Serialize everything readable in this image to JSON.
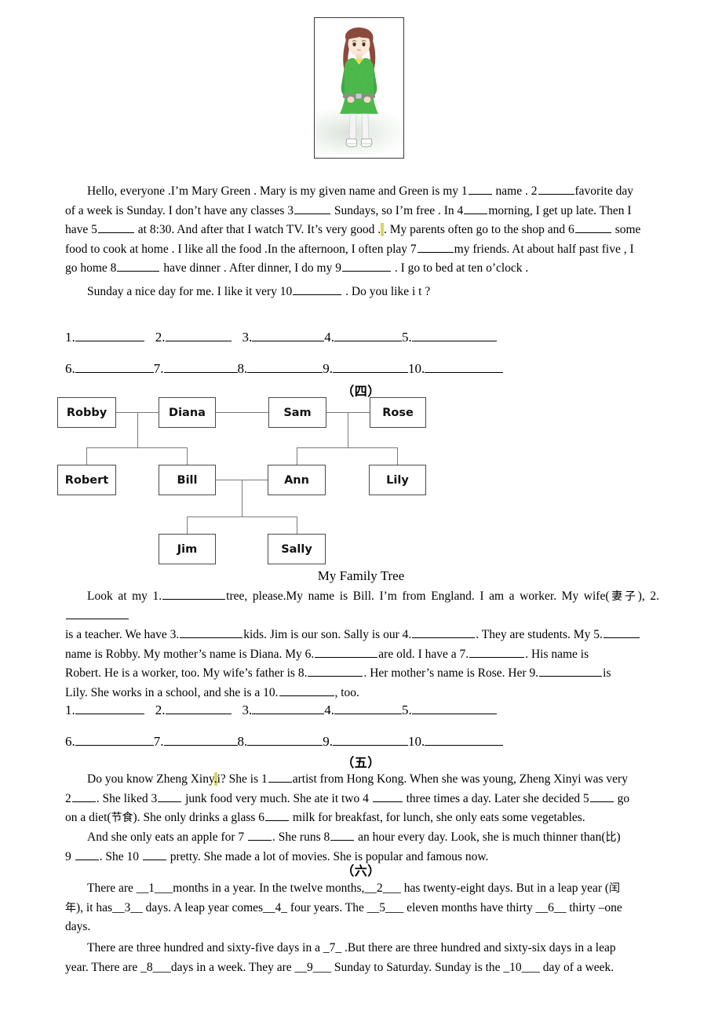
{
  "document": {
    "illustration": {
      "alt_name": "cartoon-girl-green-dress",
      "dress_color": "#4cb84c",
      "hair_color": "#8b4a3a",
      "skin_color": "#f7e0cf"
    }
  },
  "passage3": {
    "lines": [
      "Hello, everyone .I’m Mary Green . Mary is my given name and Green is my 1____ name . 2______favorite day",
      "of a week is Sunday. I don’t have any classes 3______ Sundays, so I’m free . In 4____morning, I get up late. Then I",
      "have 5______ at 8:30. And after that I watch TV. It’s very good .. My parents often go to the shop and 6______ some",
      "food to cook at home . I like all the food .In the afternoon, I often play 7______my friends. At about half past five , I",
      "go home 8_______ have dinner . After dinner, I do my 9________ . I go to bed at ten o’clock .",
      "Sunday a nice day for me. I like it very 10________ . Do you like i t ?"
    ],
    "segments_line1": [
      "Hello, everyone .I’m Mary Green . Mary is my given name and Green is my 1",
      " name . 2",
      "favorite day"
    ],
    "segments_line2": [
      "of a week is Sunday. I don’t have any classes 3",
      " Sundays, so I’m free . In 4",
      "morning, I get up late. Then I"
    ],
    "segments_line3": [
      "have 5",
      " at 8:30. And after that I watch TV. It’s very good .",
      ". My parents often go to the shop and 6",
      " some"
    ],
    "segments_line4": [
      "food to cook at home . I like all the food .In the afternoon, I often play 7",
      "my friends. At about half past five , I"
    ],
    "segments_line5": [
      "go home 8",
      " have dinner . After dinner, I do my 9",
      " . I go to bed at ten o’clock ."
    ],
    "segments_line6": [
      "Sunday a nice day for me. I like it very 10",
      " . Do you like i t ?"
    ]
  },
  "answers_block_1": {
    "row1": [
      "1.",
      "2.",
      "3.",
      "4.",
      "5."
    ],
    "row2": [
      "6.",
      "7.",
      "8.",
      "9.",
      "10."
    ]
  },
  "section_four": {
    "caption": "（四）",
    "tree_title": "My Family Tree",
    "nodes": [
      {
        "id": "robby",
        "label": "Robby"
      },
      {
        "id": "diana",
        "label": "Diana"
      },
      {
        "id": "sam",
        "label": "Sam"
      },
      {
        "id": "rose",
        "label": "Rose"
      },
      {
        "id": "robert",
        "label": "Robert"
      },
      {
        "id": "bill",
        "label": "Bill"
      },
      {
        "id": "ann",
        "label": "Ann"
      },
      {
        "id": "lily",
        "label": "Lily"
      },
      {
        "id": "jim",
        "label": "Jim"
      },
      {
        "id": "sally",
        "label": "Sally"
      }
    ],
    "passage_segments": {
      "l1a": "Look at my 1.",
      "l1b": "tree, please.My name is Bill. I’m from England. I am a worker. My wife(",
      "l1c": "妻子",
      "l1d": "), 2.",
      "l2a": "is a teacher. We have 3.",
      "l2b": "kids. Jim is our son. Sally is our 4.",
      "l2c": ". They are students. My 5.",
      "l3a": "name is Robby. My mother’s name is Diana. My 6.",
      "l3b": "are old. I have a 7.",
      "l3c": ". His name is",
      "l4a": "Robert. He is a worker, too. My wife’s father is 8.",
      "l4b": ". Her mother’s name is Rose. Her 9.",
      "l4c": "is",
      "l5a": "Lily. She works in a school, and she is a 10.",
      "l5b": ", too."
    }
  },
  "answers_block_2": {
    "row1": [
      "1.",
      "2.",
      "3.",
      "4.",
      "5."
    ],
    "row2": [
      "6.",
      "7.",
      "8.",
      "9.",
      "10."
    ]
  },
  "section_five": {
    "caption": "（五）",
    "segments": {
      "l1a": "Do you know Zheng Xiny",
      "l1hl": ".",
      "l1b": "i? She is 1",
      "l1c": "artist from Hong Kong. When she was young, Zheng Xinyi was very",
      "l2a": "2",
      "l2b": ". She liked 3",
      "l2c": " junk food very much. She ate it two 4 ",
      "l2d": " three times a day. Later she decided 5",
      "l2e": " go",
      "l3a": "on a diet(",
      "l3cn": "节食",
      "l3b": "). She only drinks a glass 6",
      "l3c": " milk for breakfast, for lunch, she only eats some vegetables.",
      "l4a": "And she only eats an apple for 7 ",
      "l4b": ". She runs 8",
      "l4c": " an hour every day. Look, she is much thinner than(",
      "l4cn": "比",
      "l4d": ")",
      "l5a": "9 ",
      "l5b": ". She 10 ",
      "l5c": " pretty. She made a lot of movies. She is popular and famous now."
    }
  },
  "section_six": {
    "caption": "（六）",
    "segments": {
      "l1a": "There are __1___months in a year. In the twelve months,__2___ has twenty-eight days. But in a leap year (",
      "l1cn": "闰",
      "l2cn": "年",
      "l2a": "), it has__3__ days. A leap year comes__4_ four years. The __5___ eleven months have thirty __6__ thirty –one",
      "l3a": "days.",
      "l4a": "There are three hundred and sixty-five days in a _7_ .But there are three hundred and sixty-six days in a leap",
      "l5a": "year. There are _8___days in a week. They are __9___ Sunday to Saturday. Sunday is the _10___ day of a week."
    }
  }
}
